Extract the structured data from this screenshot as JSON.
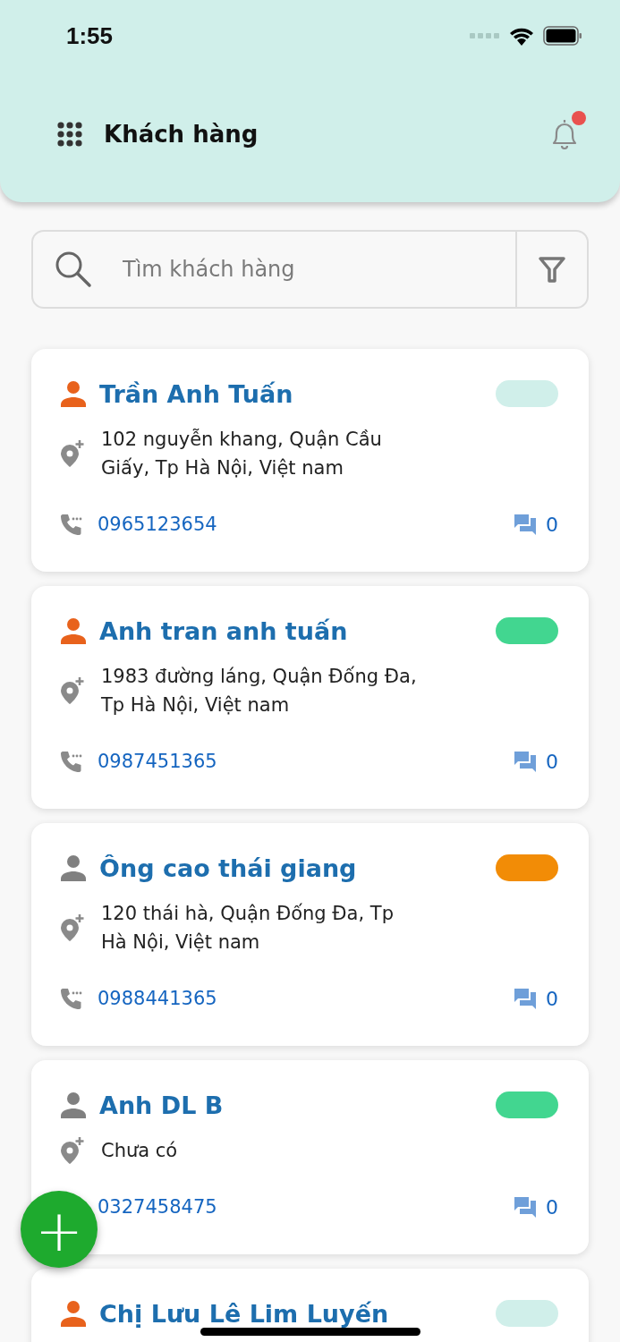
{
  "status_bar": {
    "time": "1:55"
  },
  "header": {
    "title": "Khách hàng",
    "has_notification": true
  },
  "search": {
    "placeholder": "Tìm khách hàng"
  },
  "customers": [
    {
      "name": "Trần Anh Tuấn",
      "avatar": {
        "color": "#e8621c"
      },
      "status": {
        "color": "#d0efea"
      },
      "address": "102 nguyễn khang, Quận Cầu Giấy, Tp Hà Nội, Việt nam",
      "phone": "0965123654",
      "comments": "0"
    },
    {
      "name": "Anh tran anh tuấn",
      "avatar": {
        "color": "#e8621c"
      },
      "status": {
        "color": "#42d690"
      },
      "address": "1983 đường láng, Quận Đống Đa, Tp Hà Nội, Việt nam",
      "phone": "0987451365",
      "comments": "0"
    },
    {
      "name": "Ông cao thái giang",
      "avatar": {
        "color": "#808080"
      },
      "status": {
        "color": "#f28c06"
      },
      "address": "120 thái hà, Quận Đống Đa, Tp Hà Nội, Việt nam",
      "phone": "0988441365",
      "comments": "0"
    },
    {
      "name": "Anh DL B",
      "avatar": {
        "color": "#808080"
      },
      "status": {
        "color": "#42d690"
      },
      "address": "Chưa có",
      "phone": "0327458475",
      "comments": "0"
    },
    {
      "name": "Chị Lưu Lê Lim Luyến",
      "avatar": {
        "color": "#e8621c"
      },
      "status": {
        "color": "#d0efea"
      }
    }
  ],
  "fab": {
    "label": "+"
  }
}
